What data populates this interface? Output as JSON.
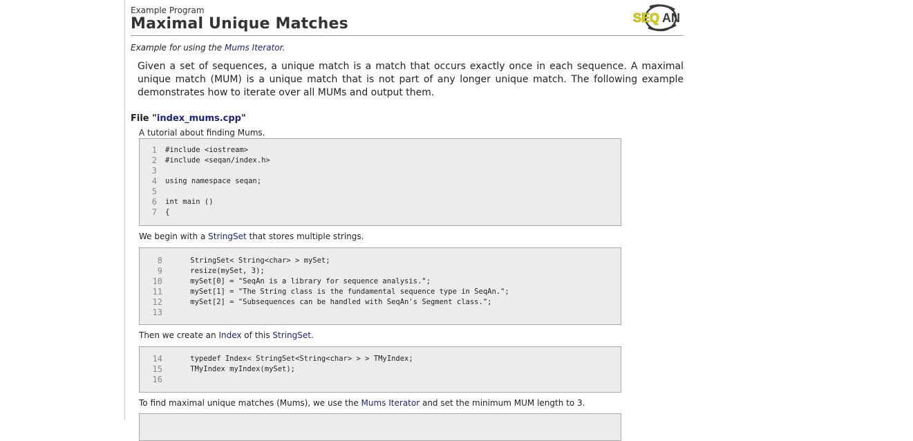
{
  "header": {
    "kicker": "Example Program",
    "title": "Maximal Unique Matches"
  },
  "logo": {
    "text": "SEQAN",
    "icon": "seqan-logo",
    "colors": {
      "yellow": "#e9e000",
      "dark": "#3a3a3a"
    }
  },
  "summary": {
    "prefix": "Example for using the ",
    "link": "Mums Iterator",
    "suffix": "."
  },
  "intro": "Given a set of sequences, a unique match is a match that occurs exactly once in each sequence. A maximal unique match (MUM) is a unique match that is not part of any longer unique match. The following example demonstrates how to iterate over all MUMs and output them.",
  "file": {
    "prefix": "File \"",
    "name": "index_mums.cpp",
    "suffix": "\""
  },
  "sections": [
    {
      "text_parts": [
        {
          "text": "A tutorial about finding Mums."
        }
      ],
      "code": [
        {
          "n": "1",
          "src": "#include <iostream>"
        },
        {
          "n": "2",
          "src": "#include <seqan/index.h>"
        },
        {
          "n": "3",
          "src": ""
        },
        {
          "n": "4",
          "src": "using namespace seqan;"
        },
        {
          "n": "5",
          "src": ""
        },
        {
          "n": "6",
          "src": "int main ()"
        },
        {
          "n": "7",
          "src": "{"
        }
      ]
    },
    {
      "text_parts": [
        {
          "text": "We begin with a "
        },
        {
          "text": "StringSet",
          "link": true
        },
        {
          "text": " that stores multiple strings."
        }
      ],
      "code": [
        {
          "n": "8",
          "src": "    StringSet< String<char> > mySet;"
        },
        {
          "n": "9",
          "src": "    resize(mySet, 3);"
        },
        {
          "n": "10",
          "src": "    mySet[0] = \"SeqAn is a library for sequence analysis.\";"
        },
        {
          "n": "11",
          "src": "    mySet[1] = \"The String class is the fundamental sequence type in SeqAn.\";"
        },
        {
          "n": "12",
          "src": "    mySet[2] = \"Subsequences can be handled with SeqAn's Segment class.\";"
        },
        {
          "n": "13",
          "src": ""
        }
      ]
    },
    {
      "text_parts": [
        {
          "text": "Then we create an "
        },
        {
          "text": "Index",
          "link": true
        },
        {
          "text": " of this "
        },
        {
          "text": "StringSet",
          "link": true
        },
        {
          "text": "."
        }
      ],
      "code": [
        {
          "n": "14",
          "src": "    typedef Index< StringSet<String<char> > > TMyIndex;"
        },
        {
          "n": "15",
          "src": "    TMyIndex myIndex(mySet);"
        },
        {
          "n": "16",
          "src": ""
        }
      ]
    },
    {
      "text_parts": [
        {
          "text": "To find maximal unique matches (Mums), we use the "
        },
        {
          "text": "Mums Iterator",
          "link": true
        },
        {
          "text": " and set the minimum MUM length to 3."
        }
      ],
      "code": []
    }
  ],
  "colors": {
    "link": "#1a237e",
    "code_bg": "#ececec",
    "code_border": "#a8a8a8",
    "line_number": "#888888"
  }
}
